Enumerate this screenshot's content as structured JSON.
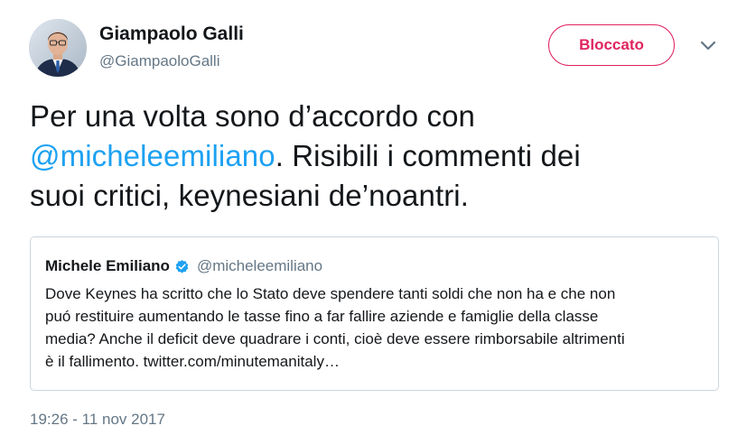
{
  "author": {
    "name": "Giampaolo Galli",
    "handle": "@GiampaoloGalli",
    "avatar_icon": "profile-photo"
  },
  "actions": {
    "blocked_label": "Bloccato",
    "menu_icon": "chevron-down-icon"
  },
  "tweet": {
    "line1": "Per una volta sono d’accordo con",
    "mention": "@micheleemiliano",
    "line2_rest": ". Risibili i commenti dei",
    "line3": "suoi critici, keynesiani de’noantri."
  },
  "quoted": {
    "name": "Michele Emiliano",
    "handle": "@micheleemiliano",
    "verified_icon": "verified-badge-icon",
    "lines": [
      "Dove Keynes ha scritto che lo Stato deve spendere tanti soldi che non ha e che non",
      "puó restituire aumentando le tasse fino a far fallire aziende e famiglie della classe",
      "media? Anche il deficit deve quadrare i conti, cioè deve essere rimborsabile altrimenti",
      "è il fallimento. twitter.com/minutemanitaly…"
    ]
  },
  "timestamp": "19:26 - 11 nov 2017",
  "colors": {
    "accent": "#1da1f2",
    "blocked": "#e0245e",
    "secondary_text": "#657786",
    "border": "#ccd6dd"
  }
}
